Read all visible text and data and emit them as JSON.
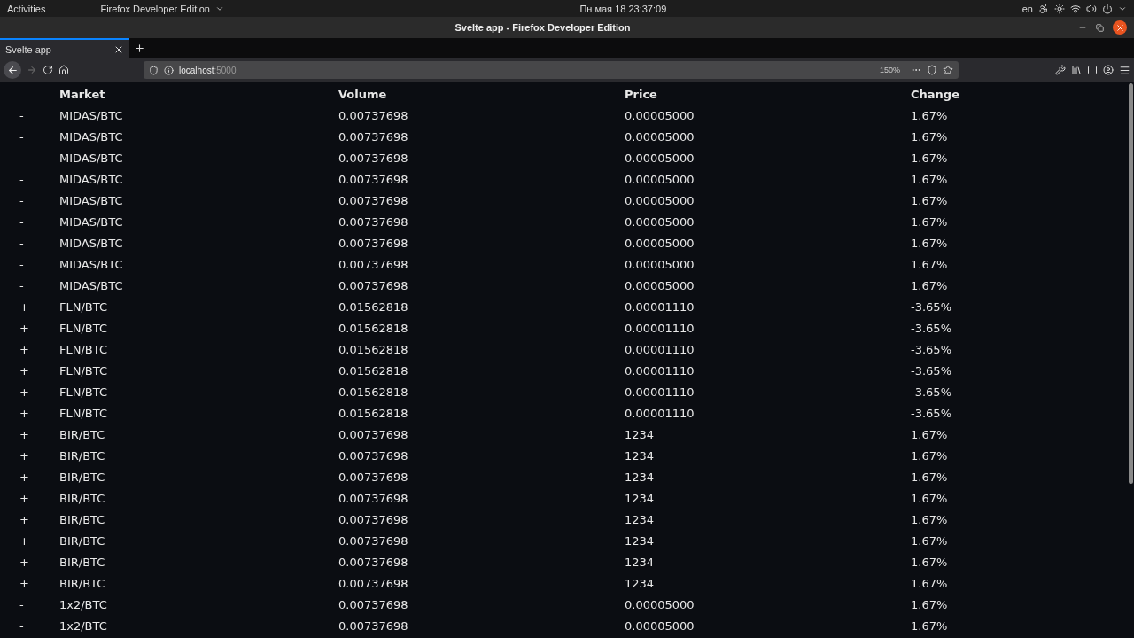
{
  "system_bar": {
    "activities": "Activities",
    "app_menu": "Firefox Developer Edition",
    "clock": "Пн мая 18  23:37:09",
    "keyboard_layout": "en"
  },
  "window": {
    "title": "Svelte app - Firefox Developer Edition"
  },
  "tabs": [
    {
      "label": "Svelte app",
      "selected": true
    }
  ],
  "address_bar": {
    "host": "localhost",
    "port": ":5000",
    "zoom": "150%"
  },
  "table": {
    "columns": [
      "Market",
      "Volume",
      "Price",
      "Change"
    ],
    "rows": [
      {
        "sign": "-",
        "market": "MIDAS/BTC",
        "volume": "0.00737698",
        "price": "0.00005000",
        "change": "1.67%"
      },
      {
        "sign": "-",
        "market": "MIDAS/BTC",
        "volume": "0.00737698",
        "price": "0.00005000",
        "change": "1.67%"
      },
      {
        "sign": "-",
        "market": "MIDAS/BTC",
        "volume": "0.00737698",
        "price": "0.00005000",
        "change": "1.67%"
      },
      {
        "sign": "-",
        "market": "MIDAS/BTC",
        "volume": "0.00737698",
        "price": "0.00005000",
        "change": "1.67%"
      },
      {
        "sign": "-",
        "market": "MIDAS/BTC",
        "volume": "0.00737698",
        "price": "0.00005000",
        "change": "1.67%"
      },
      {
        "sign": "-",
        "market": "MIDAS/BTC",
        "volume": "0.00737698",
        "price": "0.00005000",
        "change": "1.67%"
      },
      {
        "sign": "-",
        "market": "MIDAS/BTC",
        "volume": "0.00737698",
        "price": "0.00005000",
        "change": "1.67%"
      },
      {
        "sign": "-",
        "market": "MIDAS/BTC",
        "volume": "0.00737698",
        "price": "0.00005000",
        "change": "1.67%"
      },
      {
        "sign": "-",
        "market": "MIDAS/BTC",
        "volume": "0.00737698",
        "price": "0.00005000",
        "change": "1.67%"
      },
      {
        "sign": "+",
        "market": "FLN/BTC",
        "volume": "0.01562818",
        "price": "0.00001110",
        "change": "-3.65%"
      },
      {
        "sign": "+",
        "market": "FLN/BTC",
        "volume": "0.01562818",
        "price": "0.00001110",
        "change": "-3.65%"
      },
      {
        "sign": "+",
        "market": "FLN/BTC",
        "volume": "0.01562818",
        "price": "0.00001110",
        "change": "-3.65%"
      },
      {
        "sign": "+",
        "market": "FLN/BTC",
        "volume": "0.01562818",
        "price": "0.00001110",
        "change": "-3.65%"
      },
      {
        "sign": "+",
        "market": "FLN/BTC",
        "volume": "0.01562818",
        "price": "0.00001110",
        "change": "-3.65%"
      },
      {
        "sign": "+",
        "market": "FLN/BTC",
        "volume": "0.01562818",
        "price": "0.00001110",
        "change": "-3.65%"
      },
      {
        "sign": "+",
        "market": "BIR/BTC",
        "volume": "0.00737698",
        "price": "1234",
        "change": "1.67%"
      },
      {
        "sign": "+",
        "market": "BIR/BTC",
        "volume": "0.00737698",
        "price": "1234",
        "change": "1.67%"
      },
      {
        "sign": "+",
        "market": "BIR/BTC",
        "volume": "0.00737698",
        "price": "1234",
        "change": "1.67%"
      },
      {
        "sign": "+",
        "market": "BIR/BTC",
        "volume": "0.00737698",
        "price": "1234",
        "change": "1.67%"
      },
      {
        "sign": "+",
        "market": "BIR/BTC",
        "volume": "0.00737698",
        "price": "1234",
        "change": "1.67%"
      },
      {
        "sign": "+",
        "market": "BIR/BTC",
        "volume": "0.00737698",
        "price": "1234",
        "change": "1.67%"
      },
      {
        "sign": "+",
        "market": "BIR/BTC",
        "volume": "0.00737698",
        "price": "1234",
        "change": "1.67%"
      },
      {
        "sign": "+",
        "market": "BIR/BTC",
        "volume": "0.00737698",
        "price": "1234",
        "change": "1.67%"
      },
      {
        "sign": "-",
        "market": "1x2/BTC",
        "volume": "0.00737698",
        "price": "0.00005000",
        "change": "1.67%"
      },
      {
        "sign": "-",
        "market": "1x2/BTC",
        "volume": "0.00737698",
        "price": "0.00005000",
        "change": "1.67%"
      }
    ]
  }
}
